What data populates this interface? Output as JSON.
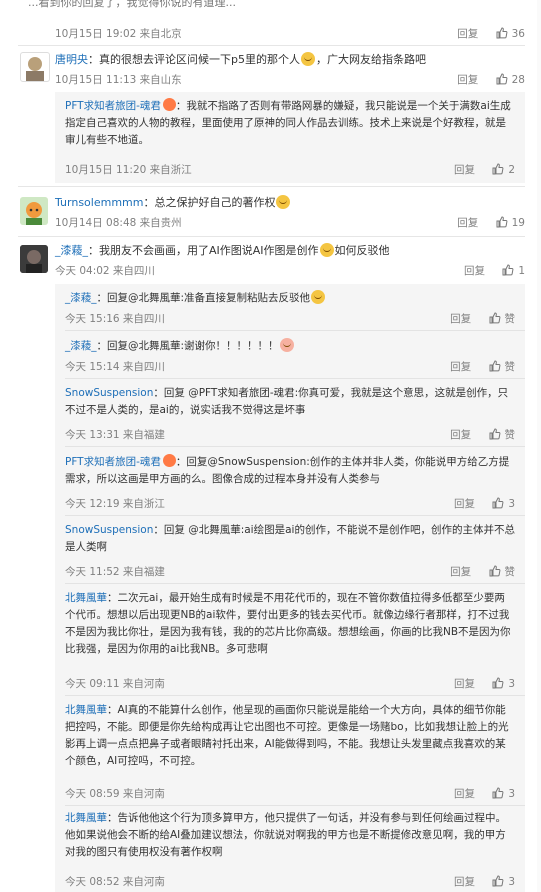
{
  "top_partial": {
    "text": "...看到你的回复了，我觉得你说的有道理...",
    "meta": "10月15日 19:02 来自北京",
    "reply": "回复",
    "likes": "36"
  },
  "comments": [
    {
      "user": "唐明央",
      "text": "：真的很想去评论区问候一下p5里的那个人",
      "text2": "，广大网友给指条路吧",
      "meta": "10月15日 11:13 来自山东",
      "reply": "回复",
      "likes": "28",
      "replies": [
        {
          "user": "PFT求知者旅团-魂君",
          "text": "：我就不指路了否则有带路网暴的嫌疑，我只能说是一个关于满数ai生成指定自己喜欢的人物的教程，里面使用了原神的同人作品去训练。技术上来说是个好教程，就是审儿有些不地道。",
          "meta": "10月15日 11:20 来自浙江",
          "reply": "回复",
          "likes": "2"
        }
      ]
    },
    {
      "user": "Turnsolemmmm",
      "text": "：总之保护好自己的著作权",
      "meta": "10月14日 08:48 来自贵州",
      "reply": "回复",
      "likes": "19",
      "replies": []
    },
    {
      "user": "_漆薐_",
      "text": "：我朋友不会画画，用了AI作图说AI作图是创作",
      "text2": "如何反驳他",
      "meta": "今天 04:02 来自四川",
      "reply": "回复",
      "likes": "1",
      "replies": [
        {
          "user": "_漆薐_",
          "text": "：回复@北舞風華:准备直接复制粘贴去反驳他",
          "meta": "今天 15:16 来自四川",
          "reply": "回复",
          "likes": "赞"
        },
        {
          "user": "_漆薐_",
          "text": "：回复@北舞風華:谢谢你！！！！！！",
          "meta": "今天 15:14 来自四川",
          "reply": "回复",
          "likes": "赞"
        },
        {
          "user": "SnowSuspension",
          "text": "：回复 @PFT求知者旅团-魂君:你真可爱，我就是这个意思，这就是创作，只不过不是人类的，是ai的，说实话我不觉得这是坏事",
          "meta": "今天 13:31 来自福建",
          "reply": "回复",
          "likes": "赞"
        },
        {
          "user": "PFT求知者旅团-魂君",
          "text": "：回复@SnowSuspension:创作的主体并非人类，你能说甲方给乙方提需求，所以这画是甲方画的么。图像合成的过程本身并没有人类参与",
          "meta": "今天 12:19 来自浙江",
          "reply": "回复",
          "likes": "3"
        },
        {
          "user": "SnowSuspension",
          "text": "：回复 @北舞風華:ai绘图是ai的创作，不能说不是创作吧，创作的主体并不总是人类啊",
          "meta": "今天 11:52 来自福建",
          "reply": "回复",
          "likes": "赞"
        },
        {
          "user": "北舞風華",
          "text": "：二次元ai，最开始生成有时候是不用花代币的，现在不管你数值拉得多低都至少要两个代币。想想以后出现更NB的ai软件，要付出更多的钱去买代币。就像边缘行者那样，打不过我不是因为我比你壮，是因为我有钱，我的的芯片比你高级。想想绘画，你画的比我NB不是因为你比我强，是因为你用的ai比我NB。多可悲啊",
          "meta": "今天 09:11 来自河南",
          "reply": "回复",
          "likes": "3"
        },
        {
          "user": "北舞風華",
          "text": "：AI真的不能算什么创作，他呈现的画面你只能说是能给一个大方向，具体的细节你能把控吗，不能。即便是你先给构成再让它出图也不可控。更像是一场赌bo，比如我想让脸上的光影再上调一点点把鼻子或者眼睛衬托出来，AI能做得到吗，不能。我想让头发里藏点我喜欢的某个颜色，AI可控吗，不可控。",
          "meta": "今天 08:59 来自河南",
          "reply": "回复",
          "likes": "3"
        },
        {
          "user": "北舞風華",
          "text": "：告诉他他这个行为顶多算甲方，他只提供了一句话，并没有参与到任何绘画过程中。他如果说他会不断的给AI叠加建议想法，你就说对啊我的甲方也是不断提修改意见啊，我的甲方对我的图只有使用权没有著作权啊",
          "meta": "今天 08:52 来自河南",
          "reply": "回复",
          "likes": "3"
        }
      ]
    }
  ]
}
